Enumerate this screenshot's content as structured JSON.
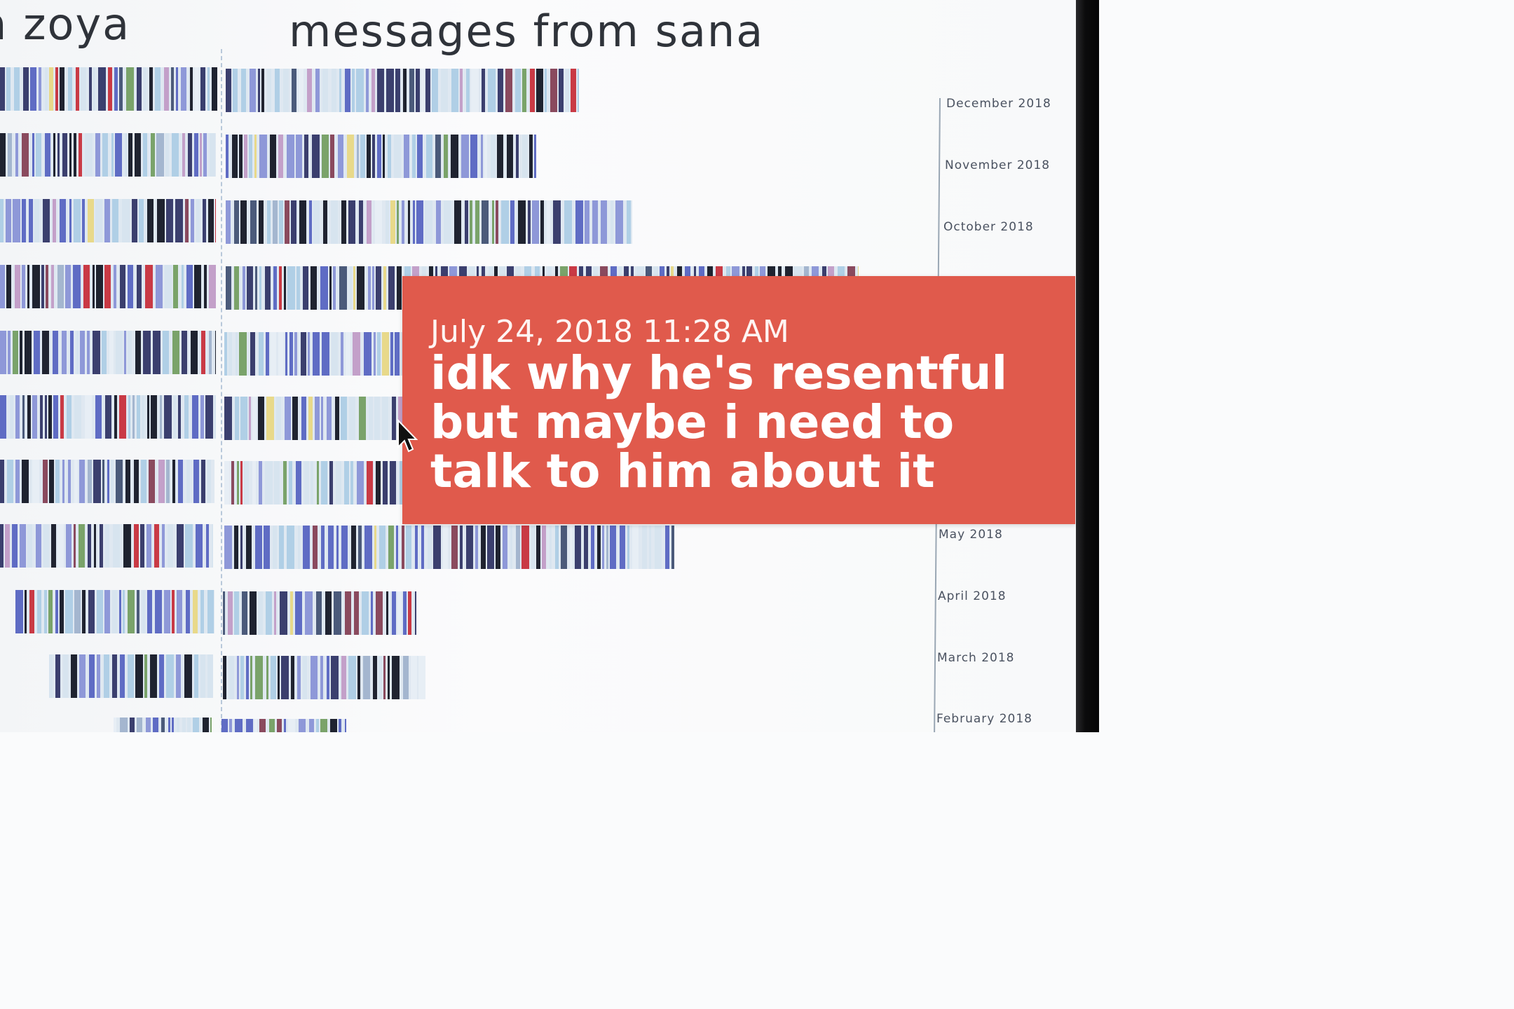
{
  "headings": {
    "left": "n zoya",
    "right": "messages from sana"
  },
  "timeline": {
    "months": [
      "December 2018",
      "November 2018",
      "October 2018",
      "May 2018",
      "April 2018",
      "March 2018",
      "February 2018"
    ]
  },
  "tooltip": {
    "timestamp": "July 24, 2018 11:28 AM",
    "message": "idk why he's resentful but maybe i need to talk to him about it"
  },
  "colors": {
    "tooltip_bg": "#e05a4c",
    "stripe_palette": [
      "#1f2330",
      "#3b3f6e",
      "#5f6cc4",
      "#8e98d8",
      "#b0cfe6",
      "#d7e4ef",
      "#c93a45",
      "#8a4a5e",
      "#c3a0c9",
      "#e8d98a",
      "#7aa36a",
      "#e7eef5",
      "#4b5a7a",
      "#a4b6cf"
    ]
  }
}
